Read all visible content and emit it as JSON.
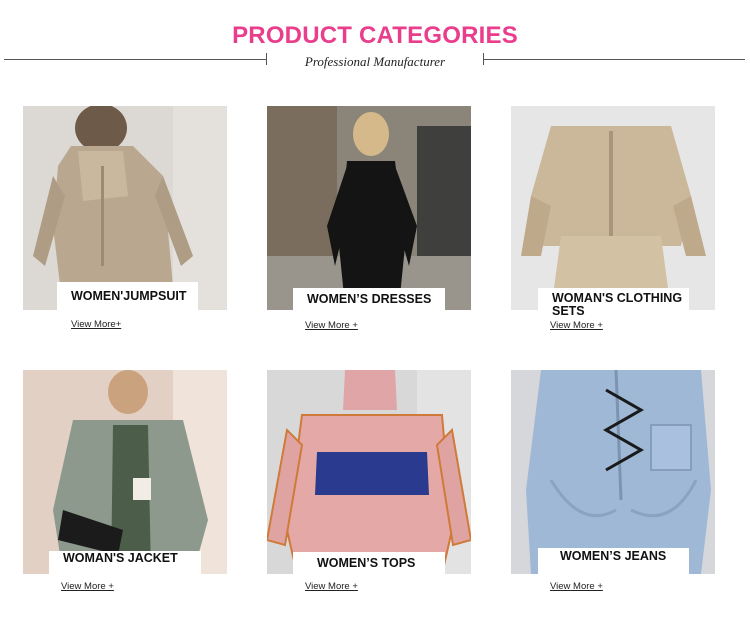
{
  "header": {
    "title": "PRODUCT CATEGORIES",
    "subtitle": "Professional Manufacturer"
  },
  "colors": {
    "accent": "#e83e8c"
  },
  "categories": [
    {
      "name": "WOMEN'JUMPSUIT",
      "more": "View More+"
    },
    {
      "name": "WOMEN’S DRESSES",
      "more": "View More +"
    },
    {
      "name": "WOMAN'S CLOTHING SETS",
      "more": "View More +"
    },
    {
      "name": "WOMAN'S JACKET",
      "more": "View More +"
    },
    {
      "name": "WOMEN’S TOPS",
      "more": "View More +"
    },
    {
      "name": "WOMEN’S JEANS",
      "more": "View More +"
    }
  ]
}
